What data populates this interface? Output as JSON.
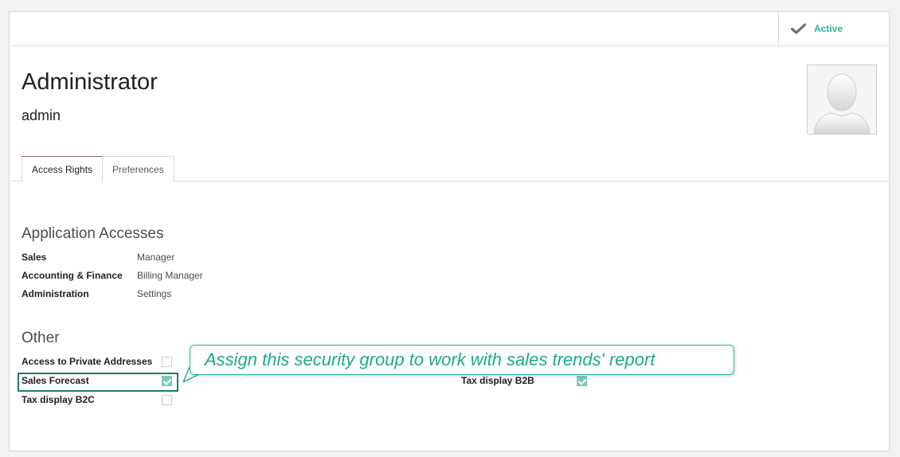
{
  "status": {
    "active_label": "Active",
    "icon": "checkmark-icon"
  },
  "user": {
    "name": "Administrator",
    "login": "admin",
    "avatar_icon": "user-silhouette-icon"
  },
  "tabs": [
    {
      "label": "Access Rights",
      "active": true
    },
    {
      "label": "Preferences",
      "active": false
    }
  ],
  "application_accesses": {
    "title": "Application Accesses",
    "rows": [
      {
        "label": "Sales",
        "value": "Manager"
      },
      {
        "label": "Accounting & Finance",
        "value": "Billing Manager"
      },
      {
        "label": "Administration",
        "value": "Settings"
      }
    ]
  },
  "other": {
    "title": "Other",
    "left": [
      {
        "label": "Access to Private Addresses",
        "checked": false
      },
      {
        "label": "Sales Forecast",
        "checked": true
      },
      {
        "label": "Tax display B2C",
        "checked": false
      }
    ],
    "right": [
      {
        "label": "Tax display B2B",
        "checked": true
      }
    ]
  },
  "callout": {
    "text": "Assign this security group to work with sales trends' report"
  },
  "colors": {
    "accent": "#21b799",
    "tab_active": "#875a7b",
    "checkbox_checked": "#7cc8c0",
    "callout": "#1fa88e"
  }
}
